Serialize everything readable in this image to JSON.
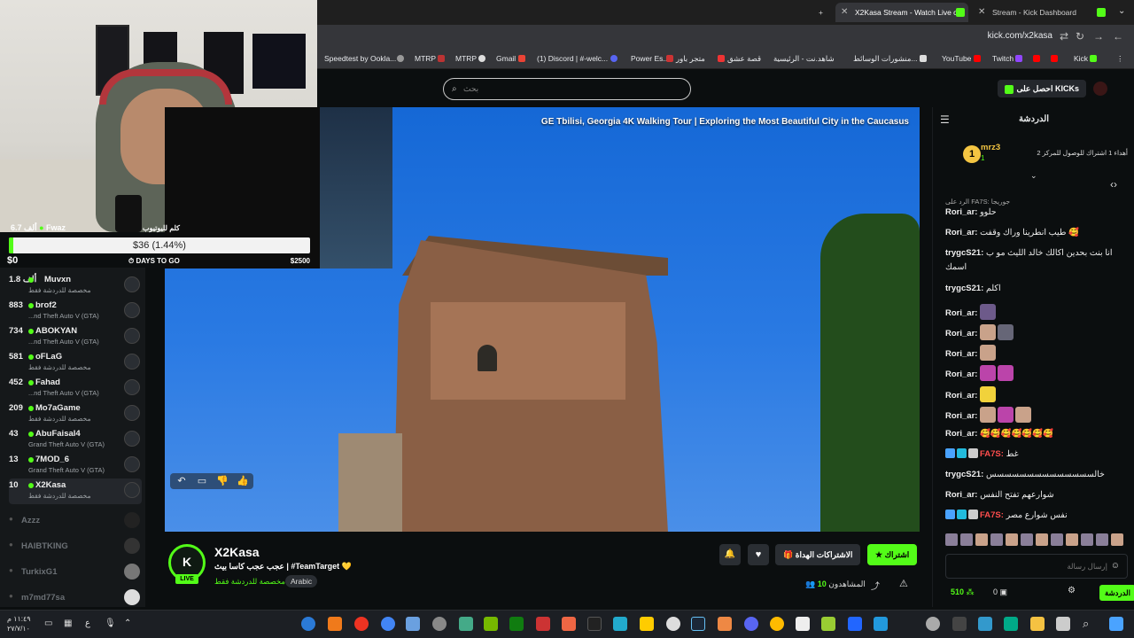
{
  "browser": {
    "tabs": [
      {
        "label": "X2Kasa Stream - Watch Live on",
        "active": true
      },
      {
        "label": "Stream - Kick Dashboard",
        "active": false
      }
    ],
    "url": "kick.com/x2kasa",
    "bookmarks": [
      "Speedtest by Ookla...",
      "MTRP",
      "MTRP",
      "Gmail",
      "(1) Discord | #-welc...",
      "Power Es...",
      "متجر باور",
      "قصة عشق",
      "شاهد.نت - الرئيسية",
      "منشورات الوسائط...",
      "YouTube",
      "Twitch",
      "Kick"
    ]
  },
  "header": {
    "search_placeholder": "بحث",
    "get_kicks": "احصل على KICKs"
  },
  "goal": {
    "user": "Fwaz",
    "user_count": "6.7 ألف",
    "title": "كلم لليوتيوب",
    "progress_text": "$36 (1.44%)",
    "progress_fraction": 0.0144,
    "start": "$0",
    "mid": "DAYS TO GO",
    "end": "$2500"
  },
  "sidebar": {
    "live": [
      {
        "name": "Muvxn",
        "count": "1.8 ألف",
        "sub": "مخصصة للدردشة فقط"
      },
      {
        "name": "brof2",
        "count": "883",
        "sub": "...nd Theft Auto V (GTA)"
      },
      {
        "name": "ABOKYAN",
        "count": "734",
        "sub": "...nd Theft Auto V (GTA)"
      },
      {
        "name": "oFLaG",
        "count": "581",
        "sub": "مخصصة للدردشة فقط"
      },
      {
        "name": "Fahad",
        "count": "452",
        "sub": "...nd Theft Auto V (GTA)"
      },
      {
        "name": "Mo7aGame",
        "count": "209",
        "sub": "مخصصة للدردشة فقط"
      },
      {
        "name": "AbuFaisal4",
        "count": "43",
        "sub": "Grand Theft Auto V (GTA)"
      },
      {
        "name": "7MOD_6",
        "count": "13",
        "sub": "Grand Theft Auto V (GTA)"
      },
      {
        "name": "X2Kasa",
        "count": "10",
        "sub": "مخصصة للدردشة فقط"
      }
    ],
    "offline": [
      "Azzz",
      "HAIBTKING",
      "TurkixG1",
      "m7md77sa"
    ]
  },
  "video": {
    "title": "Tbilisi, Georgia 4K Walking Tour | Exploring the Most Beautiful City in the Caucasus",
    "title_prefix": "GE"
  },
  "stream": {
    "channel": "X2Kasa",
    "live_label": "LIVE",
    "title": "عجب عجب كاسا بيث | #TeamTarget 💛",
    "category": "مخصصة للدردشة فقط",
    "tag": "Arabic",
    "subscribe_label": "اشتراك",
    "gift_label": "الاشتراكات الهداة",
    "viewers_label": "المشاهدون",
    "viewers_count": "10"
  },
  "chat": {
    "title": "الدردشة",
    "pinned_name": "mrz3",
    "pinned_rank": "1",
    "pinned_sub": "1",
    "pinned_text": "أهداء 1 اشتراك للوصول للمركز 2",
    "messages": [
      {
        "user": "",
        "text": "الرد على FA7S: جوريجا"
      },
      {
        "user": "Rori_ar:",
        "text": "حلوو"
      },
      {
        "user": "Rori_ar:",
        "text": "طيب انطرينا وراك وقفت 🥰"
      },
      {
        "user": "trygcS21:",
        "text": "انا بنت بحدين اكالك خالد الليث مو ب"
      },
      {
        "user": "",
        "text": "اسمك"
      },
      {
        "user": "trygcS21:",
        "text": "اكلم"
      },
      {
        "user": "Rori_ar:",
        "text": ""
      },
      {
        "user": "Rori_ar:",
        "text": ""
      },
      {
        "user": "Rori_ar:",
        "text": ""
      },
      {
        "user": "Rori_ar:",
        "text": ""
      },
      {
        "user": "Rori_ar:",
        "text": ""
      },
      {
        "user": "Rori_ar:",
        "text": ""
      },
      {
        "user": "Rori_ar:",
        "text": "🥰🥰🥰🥰🥰🥰🥰"
      },
      {
        "user": "FA7S:",
        "text": "غط"
      },
      {
        "user": "trygcS21:",
        "text": "خالسسسسسسسسسسسسسس"
      },
      {
        "user": "Rori_ar:",
        "text": "شوارعهم تفتح النفس"
      },
      {
        "user": "FA7S:",
        "text": "نفس شوارع مصر"
      }
    ],
    "input_placeholder": "إرسال رسالة",
    "send_label": "الدردشة",
    "kicks_balance": "0",
    "points_balance": "510"
  },
  "taskbar": {
    "time": "١١:٤٩ م",
    "date": "٢٧/٧/١٠"
  },
  "colors": {
    "accent": "#53fc18",
    "bg": "#0b0e0f",
    "panel": "#15181a"
  }
}
